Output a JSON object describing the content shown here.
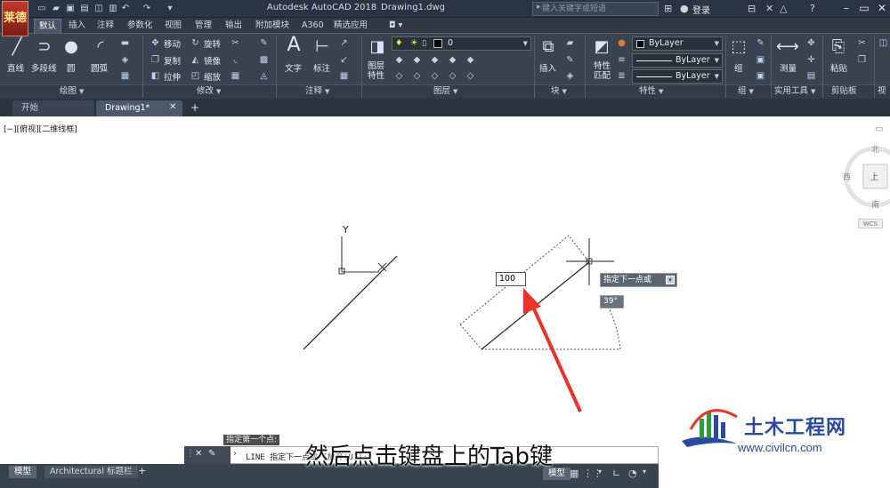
{
  "window": {
    "app_title": "Autodesk AutoCAD 2018",
    "doc_title": "Drawing1.dwg",
    "search_placeholder": "键入关键字或短语",
    "login_label": "登录",
    "logo_text": "莱德"
  },
  "ribbon_tabs": [
    "默认",
    "插入",
    "注释",
    "参数化",
    "视图",
    "管理",
    "输出",
    "附加模块",
    "A360",
    "精选应用"
  ],
  "panels": {
    "draw": {
      "label": "绘图",
      "line": "直线",
      "polyline": "多段线",
      "circle": "圆",
      "arc": "圆弧"
    },
    "modify": {
      "label": "修改",
      "move": "移动",
      "rotate": "旋转",
      "copy": "复制",
      "mirror": "镜像",
      "stretch": "拉伸",
      "scale": "缩放"
    },
    "annotation": {
      "label": "注释",
      "text": "文字",
      "dimension": "标注"
    },
    "layers": {
      "label": "图层",
      "properties": "图层\n特性",
      "current_layer": "0"
    },
    "block": {
      "label": "块",
      "insert": "插入"
    },
    "properties": {
      "label": "特性",
      "match": "特性\n匹配",
      "color": "ByLayer",
      "linetype": "ByLayer",
      "lineweight": "ByLayer"
    },
    "groups": {
      "label": "组",
      "group": "组"
    },
    "utilities": {
      "label": "实用工具",
      "measure": "测量"
    },
    "clipboard": {
      "label": "剪贴板",
      "paste": "粘贴"
    },
    "view": {
      "label": "视图"
    }
  },
  "file_tabs": {
    "start": "开始",
    "drawing": "Drawing1*",
    "new_tab": "+"
  },
  "viewport": {
    "label": "[−][俯视][二维线框]",
    "viewcube": {
      "north": "北",
      "west": "西",
      "south": "南",
      "top": "上",
      "wcs": "WCS"
    },
    "ucs_y": "Y"
  },
  "dynamic_input": {
    "length_value": "100",
    "prompt": "指定下一点或",
    "angle": "39°"
  },
  "command": {
    "history": "指定第一个点:",
    "line": "LINE 指定下一点或 [放弃(U)]:"
  },
  "status": {
    "model_tab": "模型",
    "layout_tab": "Architectural 标题栏",
    "model_btn": "模型"
  },
  "subtitle": "然后点击键盘上的Tab键",
  "watermark": {
    "name": "土木工程网",
    "url": "www.civilcn.com"
  },
  "colors": {
    "ribbon_bg": "#3b4350",
    "arrow_red": "#e8342a",
    "watermark_blue": "#2a4aa0"
  }
}
